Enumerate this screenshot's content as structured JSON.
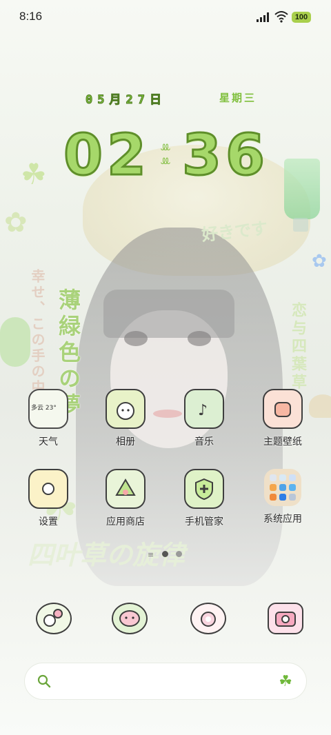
{
  "status_bar": {
    "time": "8:16",
    "battery": "100",
    "signal_icon": "signal-icon",
    "wifi_icon": "wifi-icon"
  },
  "clock_widget": {
    "date": "05月27日",
    "weekday": "星期三",
    "hour": "02",
    "minute": "36",
    "accent_color": "#7fbf3c"
  },
  "wallpaper": {
    "vertical_title": "薄緑色の夢",
    "vertical_left": "幸せ、この手の中に",
    "vertical_right": "恋与四葉草",
    "top_right_text": "好きです",
    "bottom_text": "四叶草の旋律"
  },
  "apps_row1": [
    {
      "label": "天气",
      "icon": "weather-icon",
      "widget_text": "多云 23°"
    },
    {
      "label": "相册",
      "icon": "gallery-icon"
    },
    {
      "label": "音乐",
      "icon": "music-icon"
    },
    {
      "label": "主题壁纸",
      "icon": "theme-icon"
    }
  ],
  "apps_row2": [
    {
      "label": "设置",
      "icon": "settings-icon"
    },
    {
      "label": "应用商店",
      "icon": "app-store-icon"
    },
    {
      "label": "手机管家",
      "icon": "security-icon"
    },
    {
      "label": "系统应用",
      "icon": "folder-icon"
    }
  ],
  "page_indicator": {
    "pages": 2,
    "current": 1
  },
  "dock": [
    {
      "icon": "phone-icon"
    },
    {
      "icon": "messages-icon"
    },
    {
      "icon": "browser-icon"
    },
    {
      "icon": "camera-icon"
    }
  ],
  "search_bar": {
    "placeholder": "",
    "left_icon": "search-icon",
    "right_icon": "clover-icon"
  }
}
